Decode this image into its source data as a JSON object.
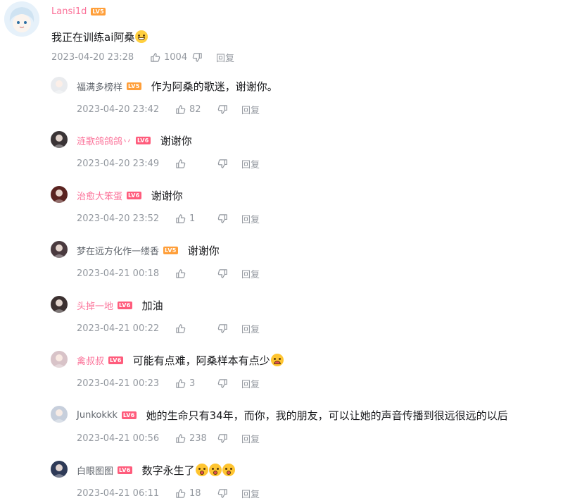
{
  "main": {
    "username": "Lansi1d",
    "level": "LV5",
    "text": "我正在训练ai阿桑",
    "emoji": "grin-emoji",
    "time": "2023-04-20 23:28",
    "likes": "1004",
    "reply_label": "回复"
  },
  "replies": [
    {
      "username": "福满多榜样",
      "level": "LV5",
      "text": "作为阿桑的歌迷，谢谢你。",
      "time": "2023-04-20 23:42",
      "likes": "82",
      "reply_label": "回复"
    },
    {
      "username": "涟歌鸽鸽鸽丷",
      "level": "LV6",
      "text": "谢谢你",
      "time": "2023-04-20 23:49",
      "likes": "",
      "reply_label": "回复"
    },
    {
      "username": "治愈大笨蛋",
      "level": "LV6",
      "text": "谢谢你",
      "time": "2023-04-20 23:52",
      "likes": "1",
      "reply_label": "回复"
    },
    {
      "username": "梦在远方化作一缕香",
      "level": "LV5",
      "text": "谢谢你",
      "time": "2023-04-21 00:18",
      "likes": "",
      "reply_label": "回复"
    },
    {
      "username": "头掉一地",
      "level": "LV6",
      "text": "加油",
      "time": "2023-04-21 00:22",
      "likes": "",
      "reply_label": "回复"
    },
    {
      "username": "禽叔叔",
      "level": "LV6",
      "text": "可能有点难，阿桑样本有点少",
      "time": "2023-04-21 00:23",
      "likes": "3",
      "reply_label": "回复"
    },
    {
      "username": "Junkokkk",
      "level": "LV6",
      "text": "她的生命只有34年，而你，我的朋友，可以让她的声音传播到很远很远的以后",
      "time": "2023-04-21 00:56",
      "likes": "238",
      "reply_label": "回复"
    },
    {
      "username": "白眼图图",
      "level": "LV6",
      "text": "数字永生了",
      "time": "2023-04-21 06:11",
      "likes": "18",
      "reply_label": "回复"
    }
  ],
  "colors": {
    "vip_name": "#fb7299",
    "meta_gray": "#9499a0",
    "lv5": "#ff9f3a",
    "lv6": "#ff5c7c"
  }
}
